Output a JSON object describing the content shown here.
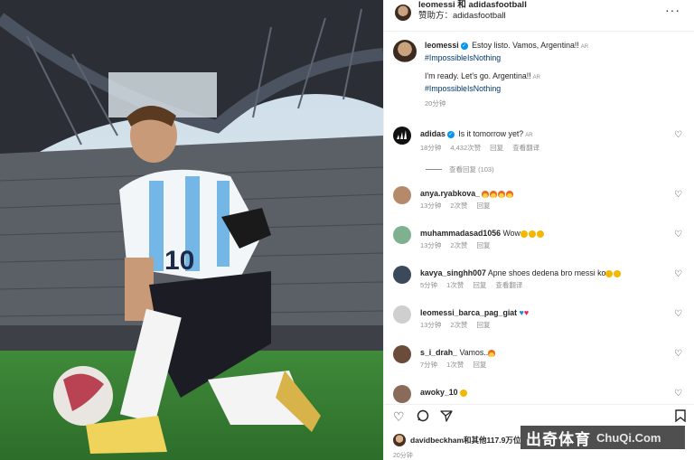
{
  "post": {
    "header_user": "leomessi 和 adidasfootball",
    "header_sub": "赞助方：adidasfootball",
    "more": "···"
  },
  "caption": {
    "user": "leomessi",
    "text1": "Estoy listo. Vamos, Argentina!!",
    "tag1": "#ImpossibleIsNothing",
    "text2": "I'm ready. Let's go. Argentina!!",
    "tag2": "#ImpossibleIsNothing",
    "ar": "AR",
    "time": "20分钟"
  },
  "comments": [
    {
      "user": "adidas",
      "text": "Is it tomorrow yet?",
      "ar": "AR",
      "time": "18分钟",
      "likes": "4,432次赞",
      "reply": "回复",
      "translate": "查看翻译",
      "avatar_color": "#111111"
    },
    {
      "user": "anya.ryabkova_",
      "text": "",
      "time": "13分钟",
      "likes": "2次赞",
      "reply": "回复",
      "avatar_color": "#b58a6a"
    },
    {
      "user": "muhammadasad1056",
      "text": "Wow",
      "time": "13分钟",
      "likes": "2次赞",
      "reply": "回复",
      "avatar_color": "#7fb08f"
    },
    {
      "user": "kavya_singhh007",
      "text": "Apne shoes dedena bro messi ko",
      "time": "5分钟",
      "likes": "1次赞",
      "reply": "回复",
      "translate": "查看翻译",
      "avatar_color": "#3a4a5a"
    },
    {
      "user": "leomessi_barca_pag_giat",
      "text": "",
      "time": "13分钟",
      "likes": "2次赞",
      "reply": "回复",
      "avatar_color": "#cfcfcf"
    },
    {
      "user": "s_i_drah_",
      "text": "Vamos..",
      "time": "7分钟",
      "likes": "1次赞",
      "reply": "回复",
      "avatar_color": "#6b4b3a"
    },
    {
      "user": "awoky_10",
      "text": "",
      "avatar_color": "#8a6a5a"
    }
  ],
  "view_replies": "查看回复 (103)",
  "likes_line": "davidbeckham和其他117.9万位",
  "time_bottom": "20分钟",
  "watermark": {
    "cn": "出奇体育",
    "en": "ChuQi.Com"
  },
  "colors": {
    "link": "#00376b",
    "muted": "#8e8e8e",
    "verified": "#0095f6"
  }
}
